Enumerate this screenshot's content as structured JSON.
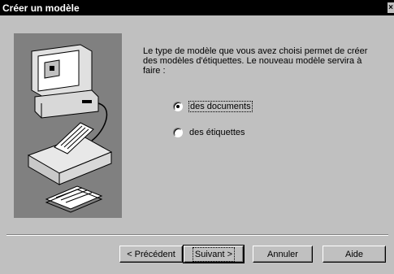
{
  "window": {
    "title": "Créer un modèle",
    "close_glyph": "×"
  },
  "content": {
    "description": "Le type de modèle que vous avez choisi permet de créer des modèles d'étiquettes. Le nouveau modèle servira à faire :",
    "options": [
      {
        "label": "des documents",
        "selected": true
      },
      {
        "label": "des étiquettes",
        "selected": false
      }
    ]
  },
  "buttons": {
    "back": "< Précédent",
    "next": "Suivant >",
    "cancel": "Annuler",
    "help": "Aide"
  },
  "illustration": {
    "icon": "computer-printer-labels-illustration"
  }
}
